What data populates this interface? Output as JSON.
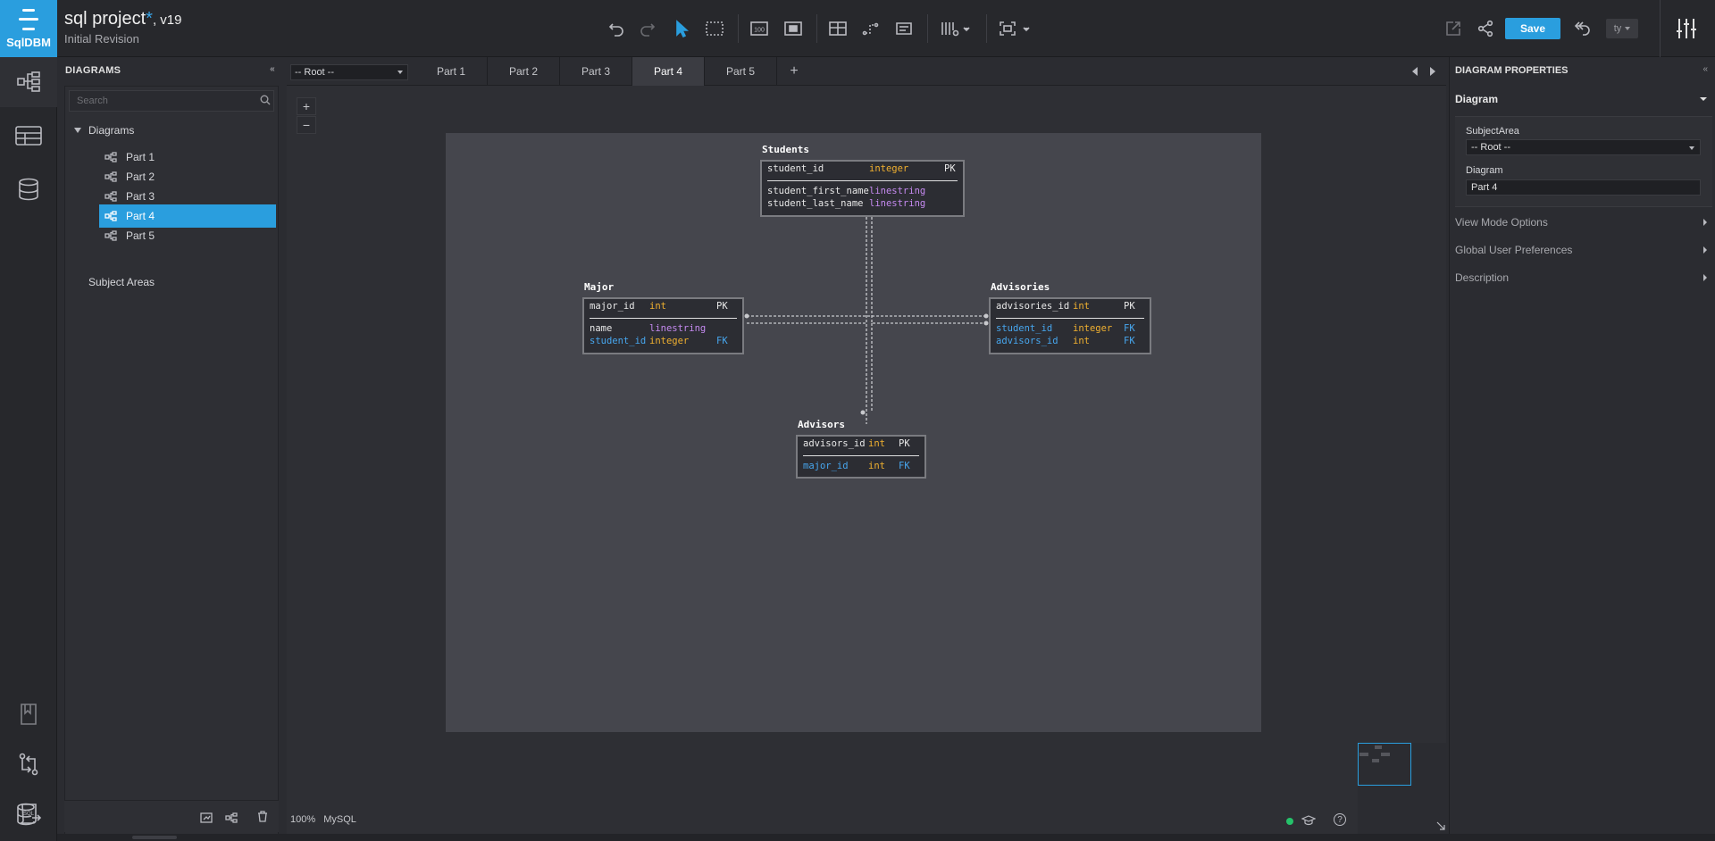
{
  "app": {
    "logo_text": "SqlDBM",
    "project_name": "sql project",
    "unsaved_mark": "*",
    "version": ", v19",
    "revision": "Initial Revision"
  },
  "toolbar": {
    "save_label": "Save",
    "user_label": "ty",
    "icons": [
      "undo-icon",
      "redo-icon",
      "select-pointer-icon",
      "marquee-select-icon",
      "zoom-100-icon",
      "fit-view-icon",
      "table-layout-icon",
      "relationship-icon",
      "note-icon",
      "column-visibility-icon",
      "fit-screen-icon",
      "external-link-icon",
      "share-icon",
      "revert-icon",
      "settings-sliders-icon"
    ],
    "zoom_100_label": "100"
  },
  "rail": {
    "items": [
      "diagram-icon",
      "tables-icon",
      "database-icon",
      "book-icon",
      "compare-icon",
      "sql-script-icon",
      "database-export-icon"
    ]
  },
  "diagrams_panel": {
    "title": "DIAGRAMS",
    "collapse": "«",
    "search_placeholder": "Search",
    "root_label": "Diagrams",
    "items": [
      {
        "label": "Part 1"
      },
      {
        "label": "Part 2"
      },
      {
        "label": "Part 3"
      },
      {
        "label": "Part 4",
        "selected": true
      },
      {
        "label": "Part 5"
      }
    ],
    "subject_areas": "Subject Areas"
  },
  "tabs": {
    "root_select": "-- Root --",
    "items": [
      {
        "label": "Part 1"
      },
      {
        "label": "Part 2"
      },
      {
        "label": "Part 3"
      },
      {
        "label": "Part 4",
        "active": true
      },
      {
        "label": "Part 5"
      }
    ],
    "add": "+"
  },
  "canvas": {
    "zoom_in": "+",
    "zoom_out": "−",
    "zoom_level": "100%",
    "db_type": "MySQL"
  },
  "entities": {
    "students": {
      "title": "Students",
      "pk_rows": [
        {
          "name": "student_id",
          "type": "integer",
          "key": "PK"
        }
      ],
      "rows": [
        {
          "name": "student_first_name",
          "type": "linestring"
        },
        {
          "name": "student_last_name",
          "type": "linestring"
        }
      ]
    },
    "major": {
      "title": "Major",
      "pk_rows": [
        {
          "name": "major_id",
          "type": "int",
          "key": "PK"
        }
      ],
      "rows": [
        {
          "name": "name",
          "type": "linestring"
        },
        {
          "name": "student_id",
          "type": "integer",
          "key": "FK"
        }
      ]
    },
    "advisories": {
      "title": "Advisories",
      "pk_rows": [
        {
          "name": "advisories_id",
          "type": "int",
          "key": "PK"
        }
      ],
      "rows": [
        {
          "name": "student_id",
          "type": "integer",
          "key": "FK"
        },
        {
          "name": "advisors_id",
          "type": "int",
          "key": "FK"
        }
      ]
    },
    "advisors": {
      "title": "Advisors",
      "pk_rows": [
        {
          "name": "advisors_id",
          "type": "int",
          "key": "PK"
        }
      ],
      "rows": [
        {
          "name": "major_id",
          "type": "int",
          "key": "FK"
        }
      ]
    }
  },
  "properties": {
    "title": "DIAGRAM PROPERTIES",
    "collapse": "«",
    "diagram_section": "Diagram",
    "subject_area_label": "SubjectArea",
    "subject_area_value": "-- Root --",
    "diagram_label": "Diagram",
    "diagram_value": "Part 4",
    "sections": [
      "View Mode Options",
      "Global User Preferences",
      "Description"
    ]
  },
  "colors": {
    "accent": "#2a9ede",
    "type_int": "#f0b030",
    "type_string": "#c58af0",
    "fk": "#47a6ee"
  }
}
